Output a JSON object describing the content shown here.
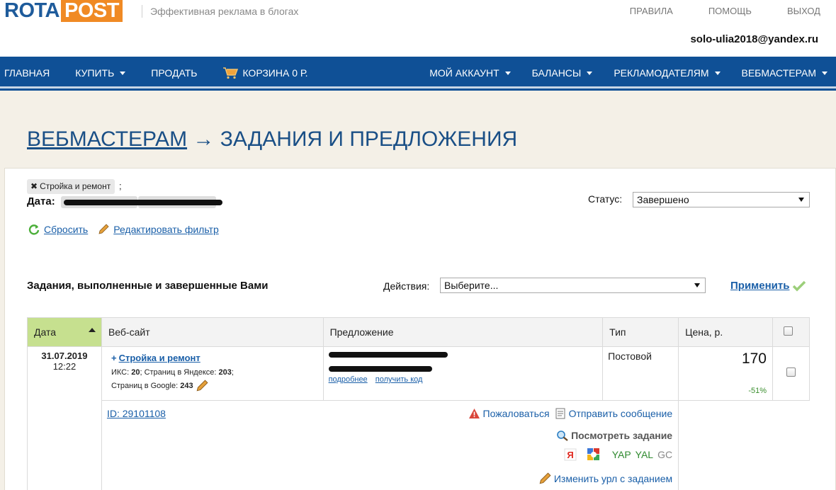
{
  "brand": {
    "logo_left": "ROTA",
    "logo_right": "POST",
    "tagline": "Эффективная реклама в блогах"
  },
  "top_links": [
    "ПРАВИЛА",
    "ПОМОЩЬ",
    "ВЫХОД"
  ],
  "user": {
    "email": "solo-ulia2018@yandex.ru"
  },
  "nav": {
    "left": [
      {
        "label": "ГЛАВНАЯ",
        "caret": false
      },
      {
        "label": "КУПИТЬ",
        "caret": true
      },
      {
        "label": "ПРОДАТЬ",
        "caret": false
      }
    ],
    "cart_label": "КОРЗИНА 0 Р.",
    "right": [
      {
        "label": "МОЙ АККАУНТ",
        "caret": true
      },
      {
        "label": "БАЛАНСЫ",
        "caret": true
      },
      {
        "label": "РЕКЛАМОДАТЕЛЯМ",
        "caret": true
      },
      {
        "label": "ВЕБМАСТЕРАМ",
        "caret": true
      }
    ]
  },
  "page": {
    "title_link": "ВЕБМАСТЕРАМ",
    "title_arrow": "→",
    "title_rest": "ЗАДАНИЯ И ПРЕДЛОЖЕНИЯ"
  },
  "filter": {
    "tag": "Стройка и ремонт",
    "tag_close": "✖",
    "tag_sep": ";",
    "date_label": "Дата:",
    "status_label": "Статус:",
    "status_value": "Завершено",
    "reset_label": "Сбросить",
    "edit_label": "Редактировать фильтр"
  },
  "list": {
    "title": "Задания, выполненные и завершенные Вами",
    "actions_label": "Действия:",
    "actions_value": "Выберите...",
    "apply_label": "Применить"
  },
  "table": {
    "headers": [
      "Дата",
      "Веб-сайт",
      "Предложение",
      "Тип",
      "Цена, р."
    ],
    "row": {
      "date": "31.07.2019",
      "time": "12:22",
      "site_plus": "+",
      "site_name": "Стройка и ремонт",
      "iks_label": "ИКС:",
      "iks": "20",
      "yandex_label": "Страниц в Яндексе:",
      "yandex_pages": "203",
      "google_label": "Страниц в Google:",
      "google_pages": "243",
      "offer_link_more": "подробнее",
      "offer_link_code": "получить код",
      "type": "Постовой",
      "price": "170",
      "price_pct": "-51%",
      "id_link": "ID: 29101108",
      "complain": "Пожаловаться",
      "send_message": "Отправить сообщение",
      "view_task": "Посмотреть задание",
      "engines": [
        "YAP",
        "YAL",
        "GC"
      ],
      "change_url": "Изменить урл с заданием"
    }
  }
}
